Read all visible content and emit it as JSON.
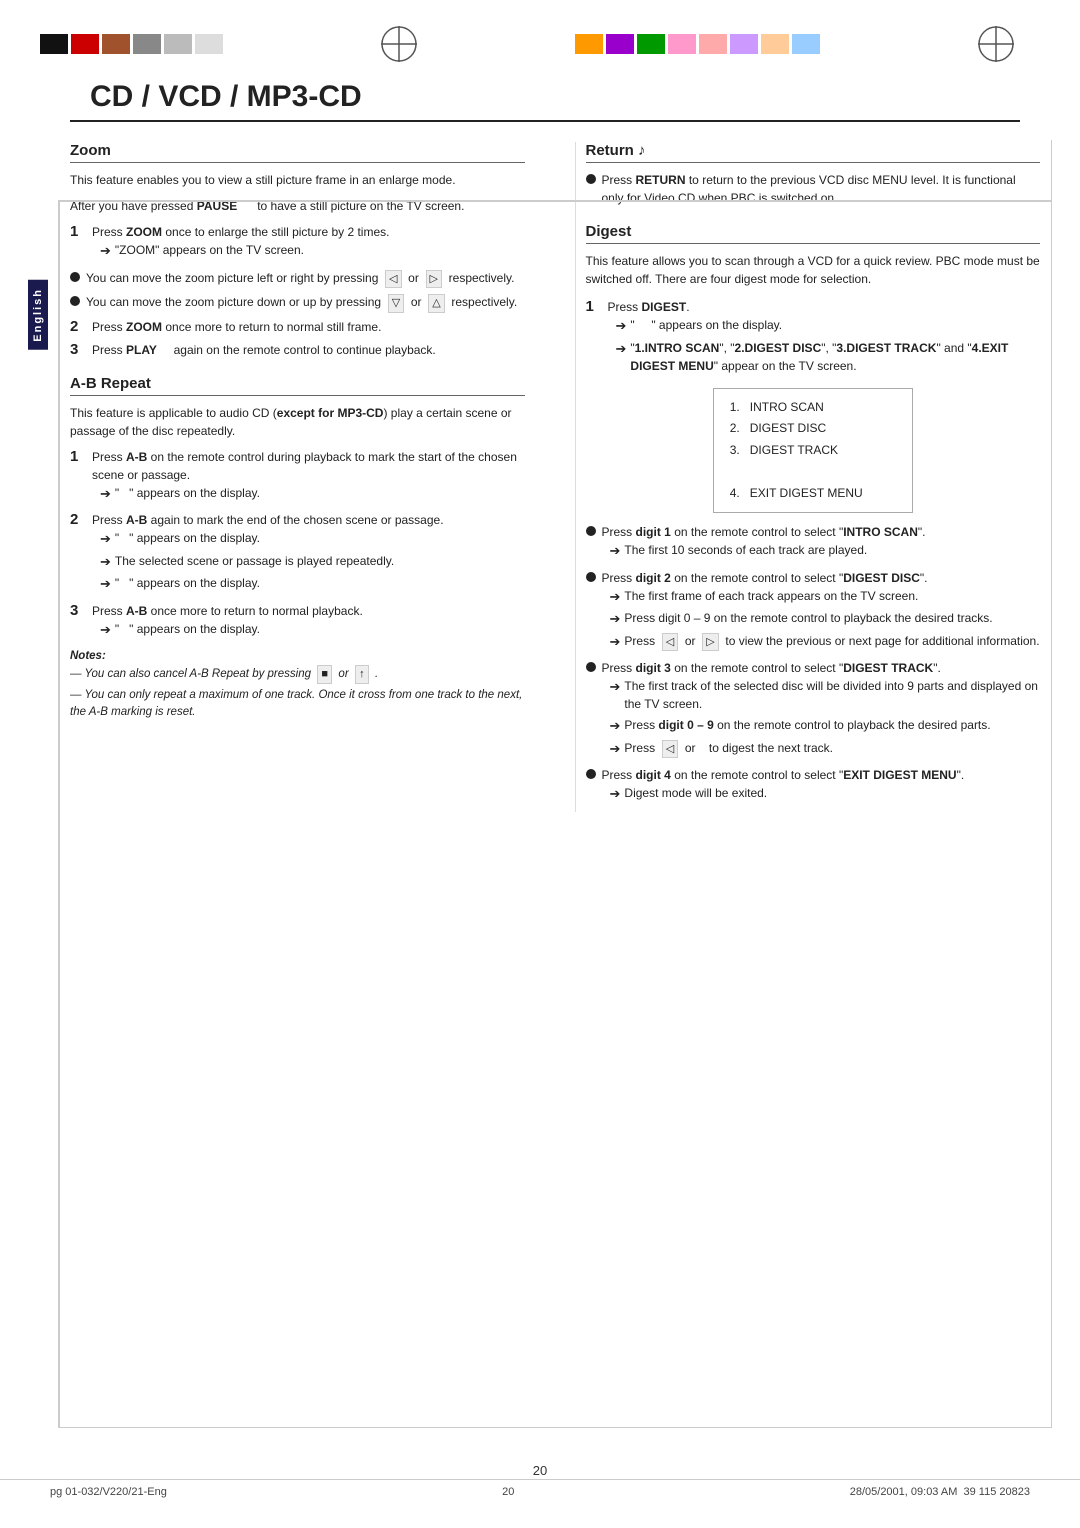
{
  "page": {
    "title": "CD / VCD / MP3-CD",
    "page_number": "20",
    "footer_left": "pg 01-032/V220/21-Eng",
    "footer_center": "20",
    "footer_right": "28/05/2001, 09:03 AM",
    "footer_code": "39 115 20823"
  },
  "sidebar": {
    "language_label": "English"
  },
  "colors": {
    "left_swatches": [
      "#000",
      "#c00",
      "#a0522d",
      "#888",
      "#bbb",
      "#ddd"
    ],
    "right_swatches": [
      "#f90",
      "#9900cc",
      "#009900",
      "#ff99cc",
      "#ff9999",
      "#cc99ff",
      "#ffcc99",
      "#99ccff"
    ]
  },
  "zoom_section": {
    "title": "Zoom",
    "intro": "This feature enables you to view a still picture frame in an enlarge mode.",
    "after_pause": "After you have pressed",
    "pause_key": "PAUSE",
    "after_pause2": "to have a still picture on the TV screen.",
    "step1_text": "Press",
    "step1_key": "ZOOM",
    "step1_rest": "once to enlarge the still picture by 2 times.",
    "step1_arrow": "\"ZOOM\" appears on the TV screen.",
    "bullet1": "You can move the zoom picture left or right by pressing  or  respectively.",
    "bullet2": "You can move the zoom picture down or up by pressing  or  respectively.",
    "step2_text": "Press",
    "step2_key": "ZOOM",
    "step2_rest": "once more to return to normal still frame.",
    "step3_text": "Press",
    "step3_key": "PLAY",
    "step3_rest": "again on the remote control to continue playback."
  },
  "ab_repeat_section": {
    "title": "A-B Repeat",
    "intro": "This feature is applicable to audio CD (except for MP3-CD) play a certain scene or passage of the disc repeatedly.",
    "step1_text": "Press",
    "step1_key": "A-B",
    "step1_rest": "on the remote control during playback to mark the start of the chosen scene or passage.",
    "step1_arrow": "\"  \" appears on the display.",
    "step2_text": "Press",
    "step2_key": "A-B",
    "step2_rest": "again to mark the end of the chosen scene or passage.",
    "step2_arrow1": "\"  \" appears on the display.",
    "step2_arrow2": "The selected scene or passage is played repeatedly.",
    "step2_arrow3": "\"  \" appears on the display.",
    "step3_text": "Press",
    "step3_key": "A-B",
    "step3_rest": "once more to return to normal playback.",
    "step3_arrow": "\"  \" appears on the display.",
    "notes_title": "Notes:",
    "note1": "— You can also cancel A-B Repeat by pressing  or  .",
    "note2": "— You can only repeat a maximum of one track. Once it cross from one track to the next, the A-B marking is reset."
  },
  "return_section": {
    "title": "Return",
    "symbol": "♫",
    "text": "Press",
    "key": "RETURN",
    "rest": "to return to the previous VCD disc MENU level. It is functional only for Video CD when PBC is switched on."
  },
  "digest_section": {
    "title": "Digest",
    "intro": "This feature allows you to scan through a VCD for a quick review. PBC mode must be switched off. There are four digest mode for selection.",
    "step1_text": "Press",
    "step1_key": "DIGEST",
    "step1_arrow1": "\"  \" appears on the display.",
    "step1_arrow2": "\"1.INTRO SCAN\", \"2.DIGEST DISC\", \"3.DIGEST TRACK\" and \"4.EXIT DIGEST MENU\" appear on the TV screen.",
    "menu_items": [
      "1.  INTRO SCAN",
      "2.  DIGEST DISC",
      "3.  DIGEST TRACK",
      "",
      "4.  EXIT DIGEST MENU"
    ],
    "bullet1_text": "Press",
    "bullet1_key": "digit 1",
    "bullet1_rest": "on the remote control to select \"INTRO SCAN\".",
    "bullet1_arrow": "The first 10 seconds of each track are played.",
    "bullet2_text": "Press",
    "bullet2_key": "digit 2",
    "bullet2_rest": "on the remote control to select \"DIGEST DISC\".",
    "bullet2_arrow1": "The first frame of each track appears on the TV screen.",
    "bullet2_arrow2": "Press digit 0 – 9 on the remote control to playback the desired tracks.",
    "bullet2_arrow3": "Press  or  to view the previous or next page for additional information.",
    "bullet3_text": "Press",
    "bullet3_key": "digit 3",
    "bullet3_rest": "on the remote control to select \"DIGEST TRACK\".",
    "bullet3_arrow1": "The first track of the selected disc will be divided into 9 parts and displayed on the TV screen.",
    "bullet3_arrow2": "Press digit 0 – 9 on the remote control to playback the desired parts.",
    "bullet3_arrow3": "Press  or  to digest the next track.",
    "bullet4_text": "Press",
    "bullet4_key": "digit 4",
    "bullet4_rest": "on the remote control to select \"EXIT DIGEST MENU\".",
    "bullet4_arrow": "Digest mode will be exited."
  }
}
